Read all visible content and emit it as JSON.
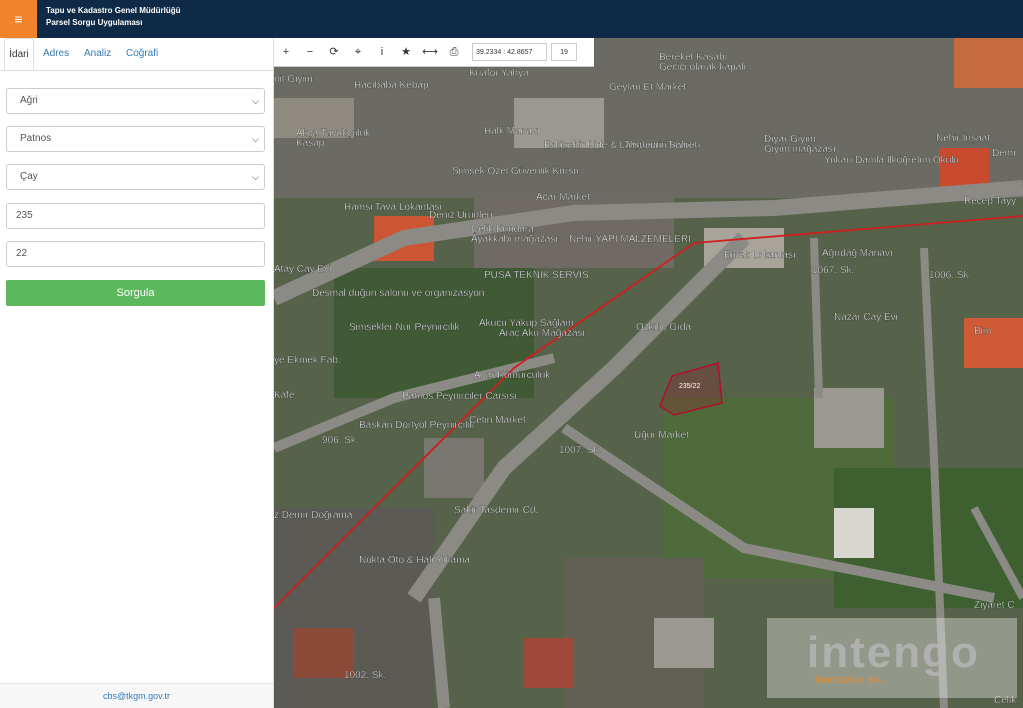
{
  "header": {
    "title_line1": "Tapu ve Kadastro Genel Müdürlüğü",
    "title_line2": "Parsel Sorgu Uygulaması",
    "menu_icon": "≡"
  },
  "tabs": [
    "İdari",
    "Adres",
    "Analiz",
    "Coğrafi"
  ],
  "form": {
    "il": "Ağri",
    "ilce": "Patnos",
    "mahalle": "Çay",
    "ada": "235",
    "parsel": "22",
    "submit": "Sorgula"
  },
  "footer": {
    "email": "cbs@tkgm.gov.tr"
  },
  "map": {
    "toolbar": {
      "icons": [
        "+",
        "−",
        "⟳",
        "⌖",
        "i",
        "★",
        "⟷",
        "⎙"
      ],
      "coordinates": "39.2334 : 42.8657",
      "zoom": "19"
    },
    "parcel_label": "235/22",
    "watermark": {
      "title": "intengo",
      "subtitle": "innovative so..."
    },
    "labels": [
      "Kuafor Yahya",
      "Bereket Kasabı",
      "Geçici olarak kapalı",
      "Geylan Et Market",
      "Hacıbaba Kebap",
      "nit Giyim",
      "Akça Tavukçuluk",
      "Kasap",
      "Halk Manavı",
      "Eskişehir Pide & Lahmacun Salonu",
      "Taşdemir Ticaret",
      "Diyar Giyim",
      "Giyim mağazası",
      "Nehir İnşaat",
      "Demi",
      "Şimşek Özel Güvenlik Kursu",
      "Yukarı Damla İlköğretim Okulu",
      "Recep Tayy",
      "Hamsi Tava Lokantası",
      "Deniz Ürünleri",
      "Acar Market",
      "Çelik Kundura",
      "Ayakkabı mağazası",
      "Nehir YAPI MALZEMELERİ",
      "Emek Lokantası",
      "Ağrıdağ Manavı",
      "Atay Çay Evi",
      "PUSA TEKNİK SERVİS",
      "Desmal düğün salonu ve organizasyon",
      "Şimşekler Nur Peynircilik",
      "Akücü Yakup Sağlam",
      "Araç Aku Mağazası",
      "Özkılıç Gıda",
      "Nazar Çay Evi",
      "Bim",
      "ye Ekmek Fab.",
      "Acar Kömürcülük",
      "Patnos Peynirciler Çarşısı",
      "Başkan Dörtyol Peynircilik",
      "Çetin Market",
      "Kafe",
      "906. Sk.",
      "1007. Sk.",
      "Uğur Market",
      "Şakir Taşdemir Cd.",
      "z Demir Doğrama",
      "Nokta Oto & Hali Yıkama",
      "1067. Sk.",
      "1006. Sk.",
      "1002. Sk.",
      "Ziyaret C",
      "Çelik"
    ]
  }
}
